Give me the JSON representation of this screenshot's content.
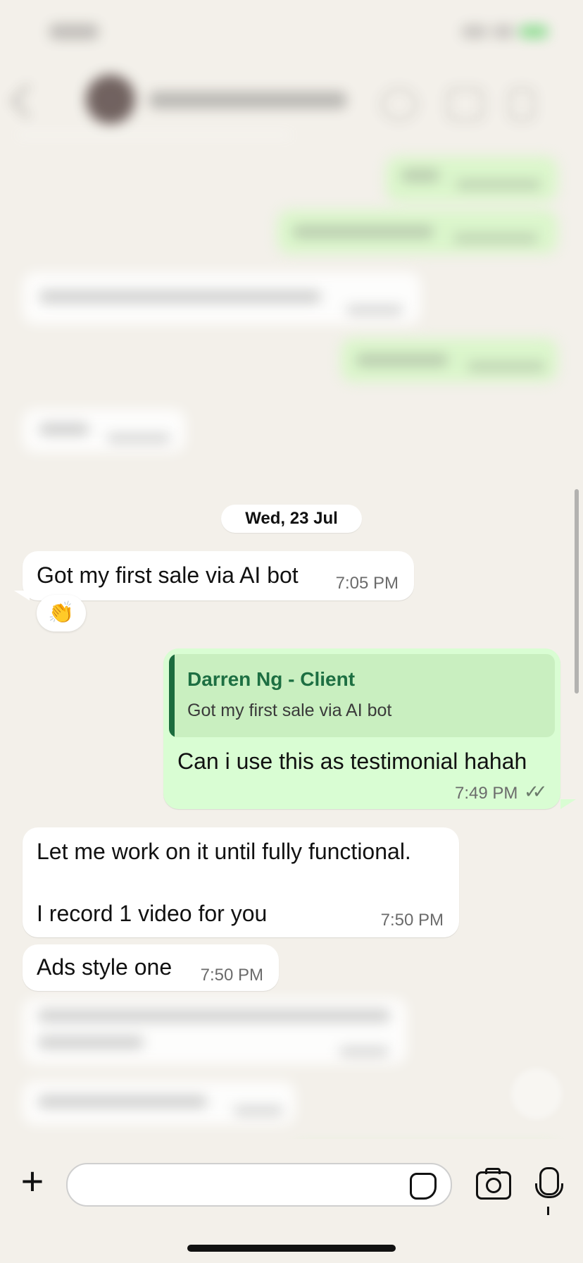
{
  "chat": {
    "date_separator": "Wed, 23 Jul",
    "messages": [
      {
        "direction": "incoming",
        "text": "Got my first sale via AI bot",
        "time": "7:05 PM",
        "reaction": "👏"
      },
      {
        "direction": "outgoing",
        "quote": {
          "author": "Darren Ng - Client",
          "text": "Got my first sale via AI bot"
        },
        "text": "Can i use this as testimonial hahah",
        "time": "7:49 PM",
        "status_icon": "double-check"
      },
      {
        "direction": "incoming",
        "text": "Let me work on it until fully functional.\n\nI record 1 video for you",
        "time": "7:50 PM"
      },
      {
        "direction": "incoming",
        "text": "Ads style one",
        "time": "7:50 PM"
      }
    ]
  },
  "composer": {
    "plus_icon": "plus-icon",
    "input_value": "",
    "sticker_icon": "sticker-icon",
    "camera_icon": "camera-icon",
    "mic_icon": "microphone-icon"
  },
  "colors": {
    "background": "#f3f0ea",
    "outgoing_bubble": "#d9fdd3",
    "incoming_bubble": "#ffffff",
    "quote_author": "#1d6f42"
  }
}
